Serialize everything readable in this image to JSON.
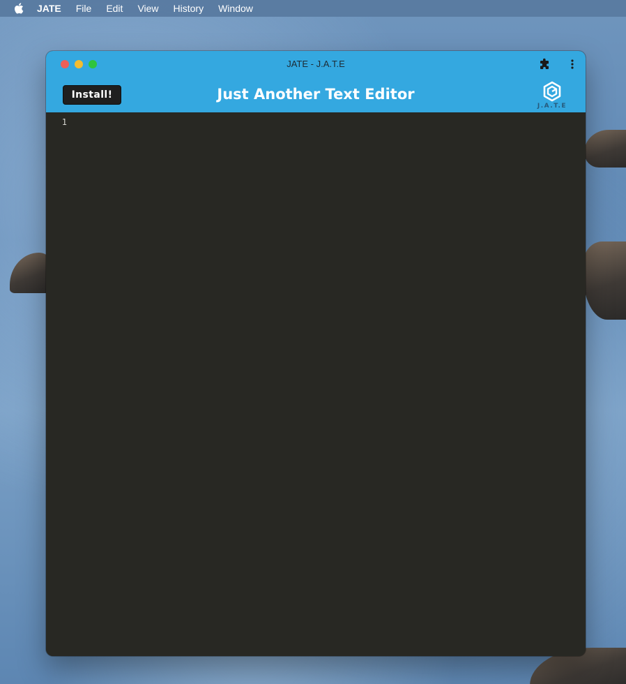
{
  "menubar": {
    "app_name": "JATE",
    "items": [
      "File",
      "Edit",
      "View",
      "History",
      "Window"
    ]
  },
  "window": {
    "title": "JATE - J.A.T.E"
  },
  "header": {
    "install_label": "Install!",
    "title": "Just Another Text Editor",
    "logo_text": "J.A.T.E"
  },
  "editor": {
    "line_numbers": [
      "1"
    ],
    "content": ""
  },
  "colors": {
    "header_blue": "#34a8e0",
    "editor_bg": "#282823",
    "install_button_bg": "#1f1f1f"
  },
  "icons": {
    "apple": "apple-icon",
    "extensions": "puzzle-icon",
    "menu": "kebab-menu-icon",
    "logo": "jate-logo-icon"
  }
}
